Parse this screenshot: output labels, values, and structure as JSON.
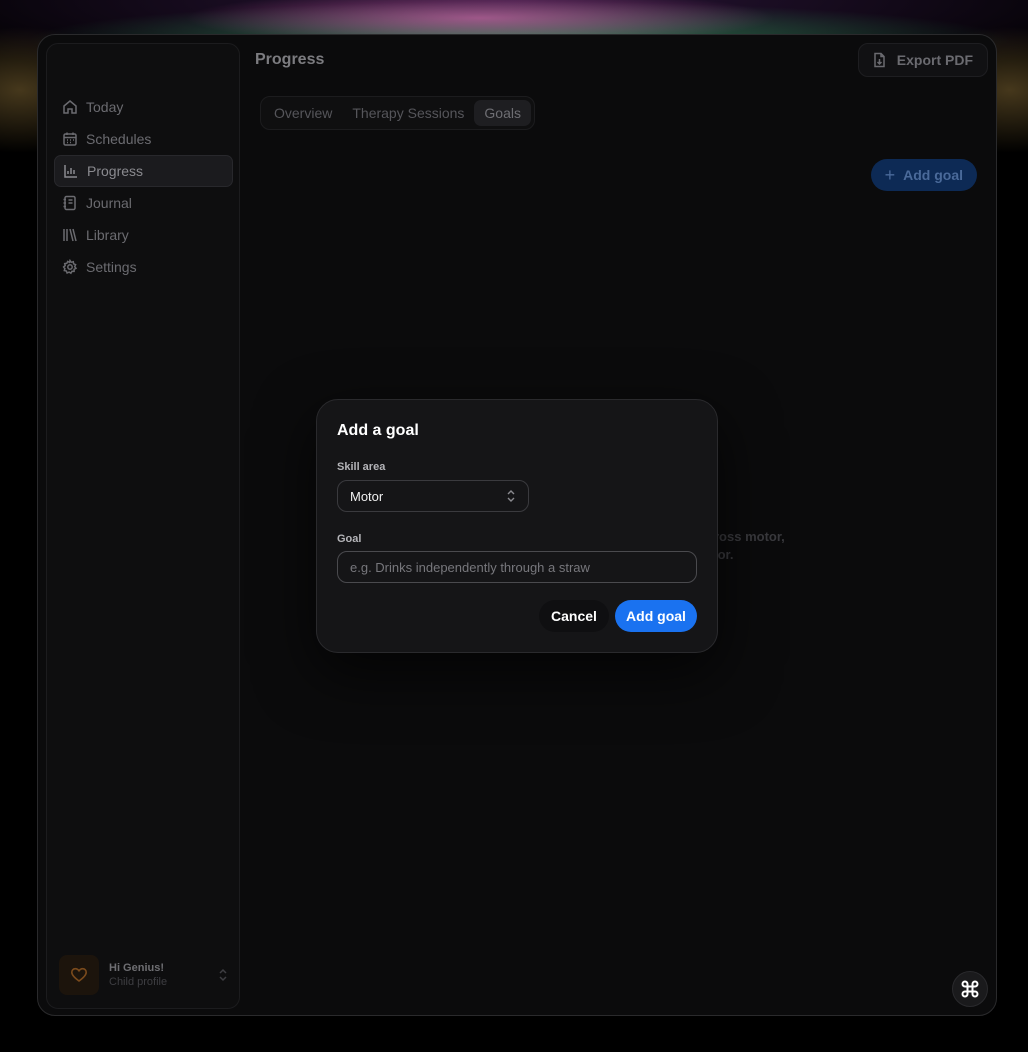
{
  "window": {
    "traffic_lights": [
      "close",
      "minimize",
      "zoom"
    ]
  },
  "sidebar": {
    "items": [
      {
        "label": "Today",
        "icon": "home-icon"
      },
      {
        "label": "Schedules",
        "icon": "calendar-icon"
      },
      {
        "label": "Progress",
        "icon": "bar-chart-icon",
        "active": true
      },
      {
        "label": "Journal",
        "icon": "notebook-icon"
      },
      {
        "label": "Library",
        "icon": "books-icon"
      },
      {
        "label": "Settings",
        "icon": "gear-icon"
      }
    ],
    "profile": {
      "name": "Hi Genius!",
      "subtitle": "Child profile",
      "icon": "heart-icon"
    }
  },
  "header": {
    "title": "Progress",
    "export_label": "Export PDF"
  },
  "tabs": [
    {
      "label": "Overview"
    },
    {
      "label": "Therapy Sessions"
    },
    {
      "label": "Goals",
      "active": true
    }
  ],
  "main": {
    "add_goal_label": "Add goal",
    "empty_line1": "ross motor,",
    "empty_line2": "ior."
  },
  "modal": {
    "title": "Add a goal",
    "skill_area_label": "Skill area",
    "skill_area_value": "Motor",
    "goal_label": "Goal",
    "goal_value": "",
    "goal_placeholder": "e.g. Drinks independently through a straw",
    "cancel_label": "Cancel",
    "submit_label": "Add goal"
  },
  "colors": {
    "accent": "#1a72f0",
    "background": "#0b0b0c"
  }
}
